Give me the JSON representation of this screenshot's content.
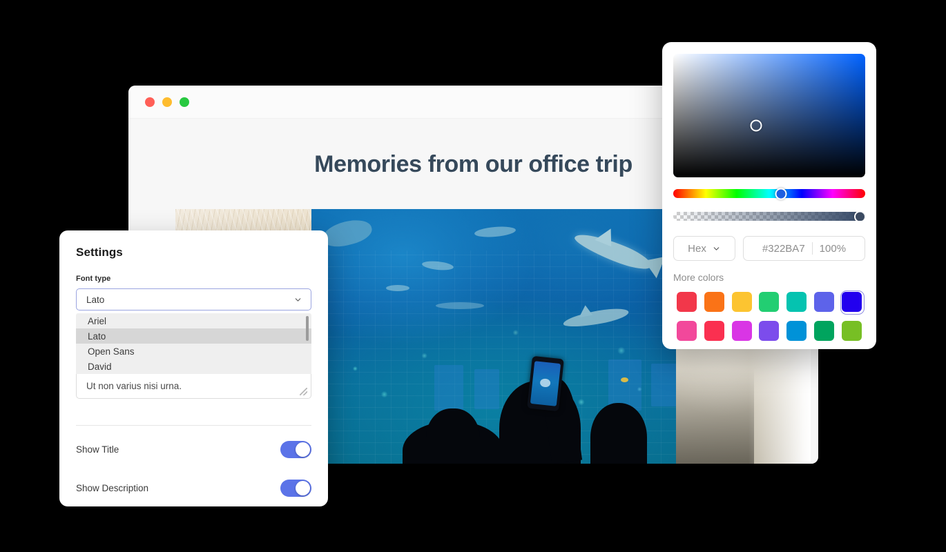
{
  "browser": {
    "traffic_lights": [
      "close",
      "minimize",
      "maximize"
    ],
    "page_title": "Memories from our office trip",
    "gallery": [
      {
        "alt": "blonde-fur-closeup"
      },
      {
        "alt": "aquarium-shark-tank-silhouettes"
      },
      {
        "alt": "beige-sofa-cushion"
      }
    ]
  },
  "settings": {
    "title": "Settings",
    "font_type": {
      "label": "Font type",
      "value": "Lato",
      "options": [
        "Ariel",
        "Lato",
        "Open Sans",
        "David"
      ],
      "selected_option": "Lato"
    },
    "description_field": {
      "value": "Ut non varius nisi urna."
    },
    "toggles": [
      {
        "label": "Show Title",
        "on": true
      },
      {
        "label": "Show Description",
        "on": true
      }
    ],
    "toggle_color": "#5B73E8"
  },
  "color_picker": {
    "format_label": "Hex",
    "hex_value": "#322BA7",
    "opacity_value": "100%",
    "more_colors_label": "More colors",
    "current_color": "#322BA7",
    "swatches_row1": [
      "#F2374A",
      "#FA7317",
      "#FCC431",
      "#22CE72",
      "#05C3B0",
      "#5D63EA",
      "#2200EE"
    ],
    "swatches_row2": [
      "#F2489B",
      "#FA3050",
      "#D935E5",
      "#7C4CEC",
      "#0092D8",
      "#00A45E",
      "#77BF24"
    ],
    "active_swatch_index": 6
  }
}
